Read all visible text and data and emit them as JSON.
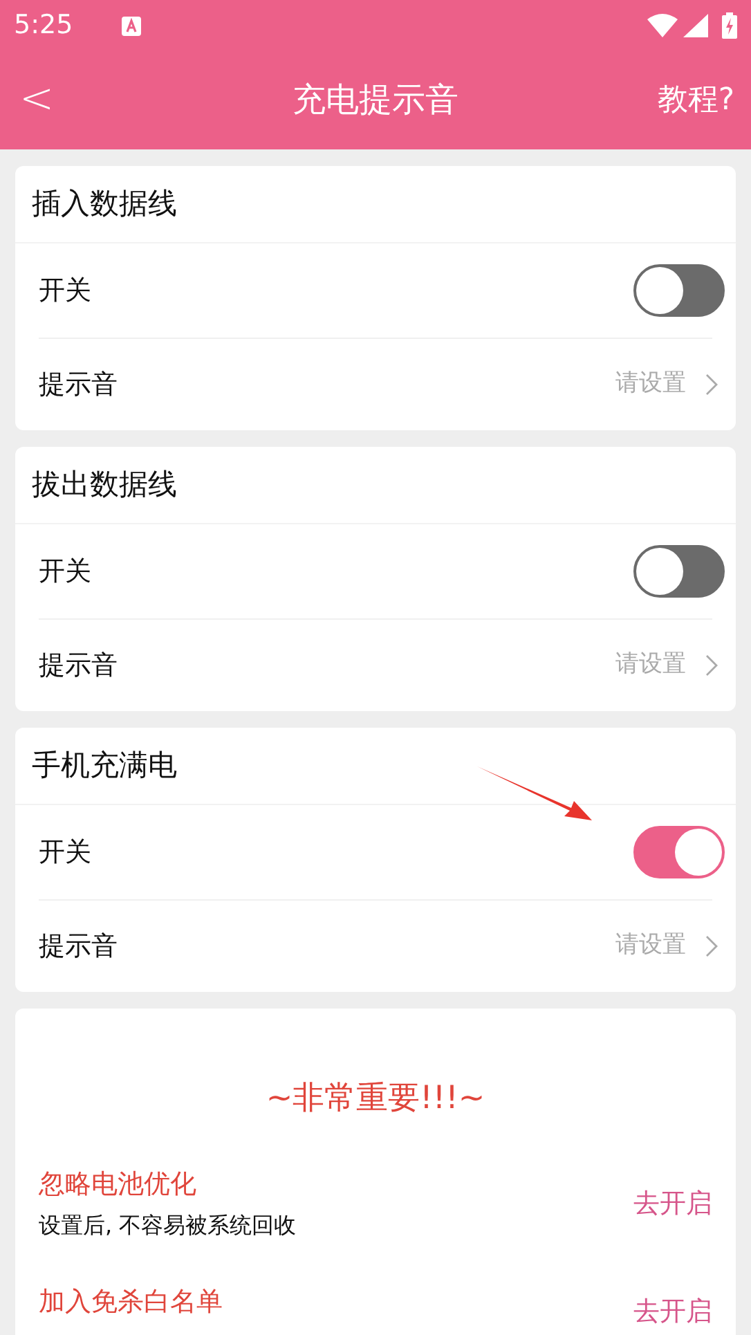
{
  "status_bar": {
    "time": "5:25"
  },
  "header": {
    "back": "<",
    "title": "充电提示音",
    "help": "教程?"
  },
  "sections": [
    {
      "title": "插入数据线",
      "switch_label": "开关",
      "on": false,
      "sound_label": "提示音",
      "sound_value": "请设置"
    },
    {
      "title": "拔出数据线",
      "switch_label": "开关",
      "on": false,
      "sound_label": "提示音",
      "sound_value": "请设置"
    },
    {
      "title": "手机充满电",
      "switch_label": "开关",
      "on": true,
      "sound_label": "提示音",
      "sound_value": "请设置"
    }
  ],
  "important": {
    "heading": "~非常重要!!!~",
    "items": [
      {
        "title": "忽略电池优化",
        "description": "设置后, 不容易被系统回收",
        "action": "去开启"
      },
      {
        "title": "加入免杀白名单",
        "action": "去开启"
      }
    ]
  }
}
